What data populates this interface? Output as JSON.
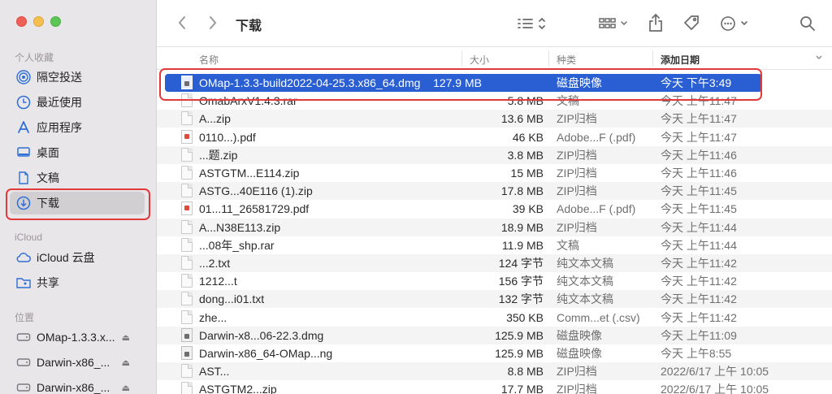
{
  "window": {
    "title": "下载"
  },
  "sidebar": {
    "sections": [
      {
        "label": "个人收藏"
      },
      {
        "label": "iCloud"
      },
      {
        "label": "位置"
      }
    ],
    "items": [
      {
        "label": "隔空投送",
        "icon": "airdrop-icon"
      },
      {
        "label": "最近使用",
        "icon": "clock-icon"
      },
      {
        "label": "应用程序",
        "icon": "applications-icon"
      },
      {
        "label": "桌面",
        "icon": "desktop-icon"
      },
      {
        "label": "文稿",
        "icon": "document-icon"
      },
      {
        "label": "下载",
        "icon": "download-icon",
        "selected": true
      },
      {
        "label": "iCloud 云盘",
        "icon": "cloud-icon"
      },
      {
        "label": "共享",
        "icon": "shared-folder-icon"
      },
      {
        "label": "OMap-1.3.3.x...",
        "icon": "disk-icon"
      },
      {
        "label": "Darwin-x86_...",
        "icon": "disk-icon"
      },
      {
        "label": "Darwin-x86_...",
        "icon": "disk-icon"
      }
    ]
  },
  "toolbar": {
    "back": "back-icon",
    "forward": "forward-icon",
    "view": "list-view-icon",
    "group": "group-icon",
    "share": "share-icon",
    "tag": "tag-icon",
    "more": "more-icon",
    "search": "search-icon"
  },
  "columns": {
    "name": "名称",
    "size": "大小",
    "kind": "种类",
    "date": "添加日期"
  },
  "files": [
    {
      "name": "OMap-1.3.3-build2022-04-25.3.x86_64.dmg",
      "size": "127.9 MB",
      "kind": "磁盘映像",
      "date": "今天 下午3:49",
      "icon": "dmg-icon",
      "selected": true
    },
    {
      "name": "OmabArxV1.4.3.rar",
      "size": "5.8 MB",
      "kind": "文稿",
      "date": "今天 上午11:47",
      "icon": "doc-icon"
    },
    {
      "name": "A...zip",
      "size": "13.6 MB",
      "kind": "ZIP归档",
      "date": "今天 上午11:47",
      "icon": "doc-icon"
    },
    {
      "name": "0110...).pdf",
      "size": "46 KB",
      "kind": "Adobe...F (.pdf)",
      "date": "今天 上午11:47",
      "icon": "pdf-icon"
    },
    {
      "name": "...题.zip",
      "size": "3.8 MB",
      "kind": "ZIP归档",
      "date": "今天 上午11:46",
      "icon": "doc-icon"
    },
    {
      "name": "ASTGTM...E114.zip",
      "size": "15 MB",
      "kind": "ZIP归档",
      "date": "今天 上午11:46",
      "icon": "doc-icon"
    },
    {
      "name": "ASTG...40E116 (1).zip",
      "size": "17.8 MB",
      "kind": "ZIP归档",
      "date": "今天 上午11:45",
      "icon": "doc-icon"
    },
    {
      "name": "01...11_26581729.pdf",
      "size": "39 KB",
      "kind": "Adobe...F (.pdf)",
      "date": "今天 上午11:45",
      "icon": "pdf-icon"
    },
    {
      "name": "A...N38E113.zip",
      "size": "18.9 MB",
      "kind": "ZIP归档",
      "date": "今天 上午11:44",
      "icon": "doc-icon"
    },
    {
      "name": "...08年_shp.rar",
      "size": "11.9 MB",
      "kind": "文稿",
      "date": "今天 上午11:44",
      "icon": "doc-icon"
    },
    {
      "name": "...2.txt",
      "size": "124 字节",
      "kind": "纯文本文稿",
      "date": "今天 上午11:42",
      "icon": "doc-icon"
    },
    {
      "name": "1212...t",
      "size": "156 字节",
      "kind": "纯文本文稿",
      "date": "今天 上午11:42",
      "icon": "doc-icon"
    },
    {
      "name": "dong...i01.txt",
      "size": "132 字节",
      "kind": "纯文本文稿",
      "date": "今天 上午11:42",
      "icon": "doc-icon"
    },
    {
      "name": "zhe...",
      "size": "350 KB",
      "kind": "Comm...et (.csv)",
      "date": "今天 上午11:42",
      "icon": "doc-icon"
    },
    {
      "name": "Darwin-x8...06-22.3.dmg",
      "size": "125.9 MB",
      "kind": "磁盘映像",
      "date": "今天 上午11:09",
      "icon": "dmg-icon"
    },
    {
      "name": "Darwin-x86_64-OMap...ng",
      "size": "125.9 MB",
      "kind": "磁盘映像",
      "date": "今天 上午8:55",
      "icon": "dmg-icon"
    },
    {
      "name": "AST...",
      "size": "8.8 MB",
      "kind": "ZIP归档",
      "date": "2022/6/17 上午 10:05",
      "icon": "doc-icon"
    },
    {
      "name": "ASTGTM2...zip",
      "size": "17.7 MB",
      "kind": "ZIP归档",
      "date": "2022/6/17 上午 10:05",
      "icon": "doc-icon"
    }
  ]
}
